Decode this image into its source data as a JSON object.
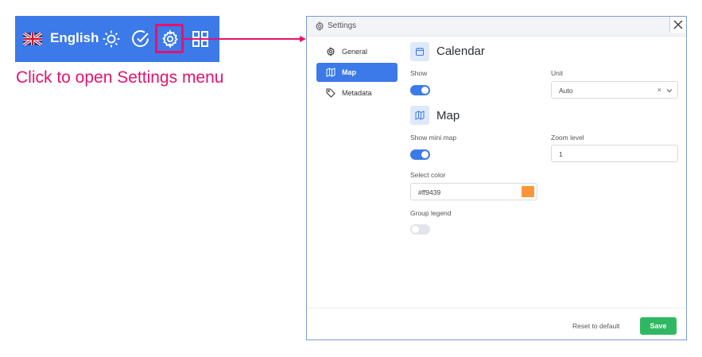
{
  "toolbar": {
    "language_label": "English",
    "icons": [
      "uk-flag-icon",
      "sun-icon",
      "check-circle-icon",
      "gear-icon",
      "grid-icon"
    ]
  },
  "caption": "Click to open Settings menu",
  "dialog": {
    "title": "Settings",
    "nav": [
      {
        "label": "General",
        "icon": "gear-icon",
        "active": false
      },
      {
        "label": "Map",
        "icon": "map-icon",
        "active": true
      },
      {
        "label": "Metadata",
        "icon": "tag-icon",
        "active": false
      }
    ],
    "calendar": {
      "title": "Calendar",
      "show_label": "Show",
      "show_on": true,
      "unit_label": "Unit",
      "unit_value": "Auto",
      "unit_clear": "×"
    },
    "map": {
      "title": "Map",
      "show_mini_map_label": "Show mini map",
      "show_mini_map_on": true,
      "zoom_label": "Zoom level",
      "zoom_value": "1",
      "color_label": "Select color",
      "color_value": "#ff9439",
      "group_legend_label": "Group legend",
      "group_legend_on": false
    },
    "footer": {
      "reset_label": "Reset to default",
      "save_label": "Save"
    }
  },
  "colors": {
    "accent": "#3b7ae8",
    "highlight": "#e5126e",
    "save": "#2fb861",
    "swatch": "#ff9439"
  }
}
